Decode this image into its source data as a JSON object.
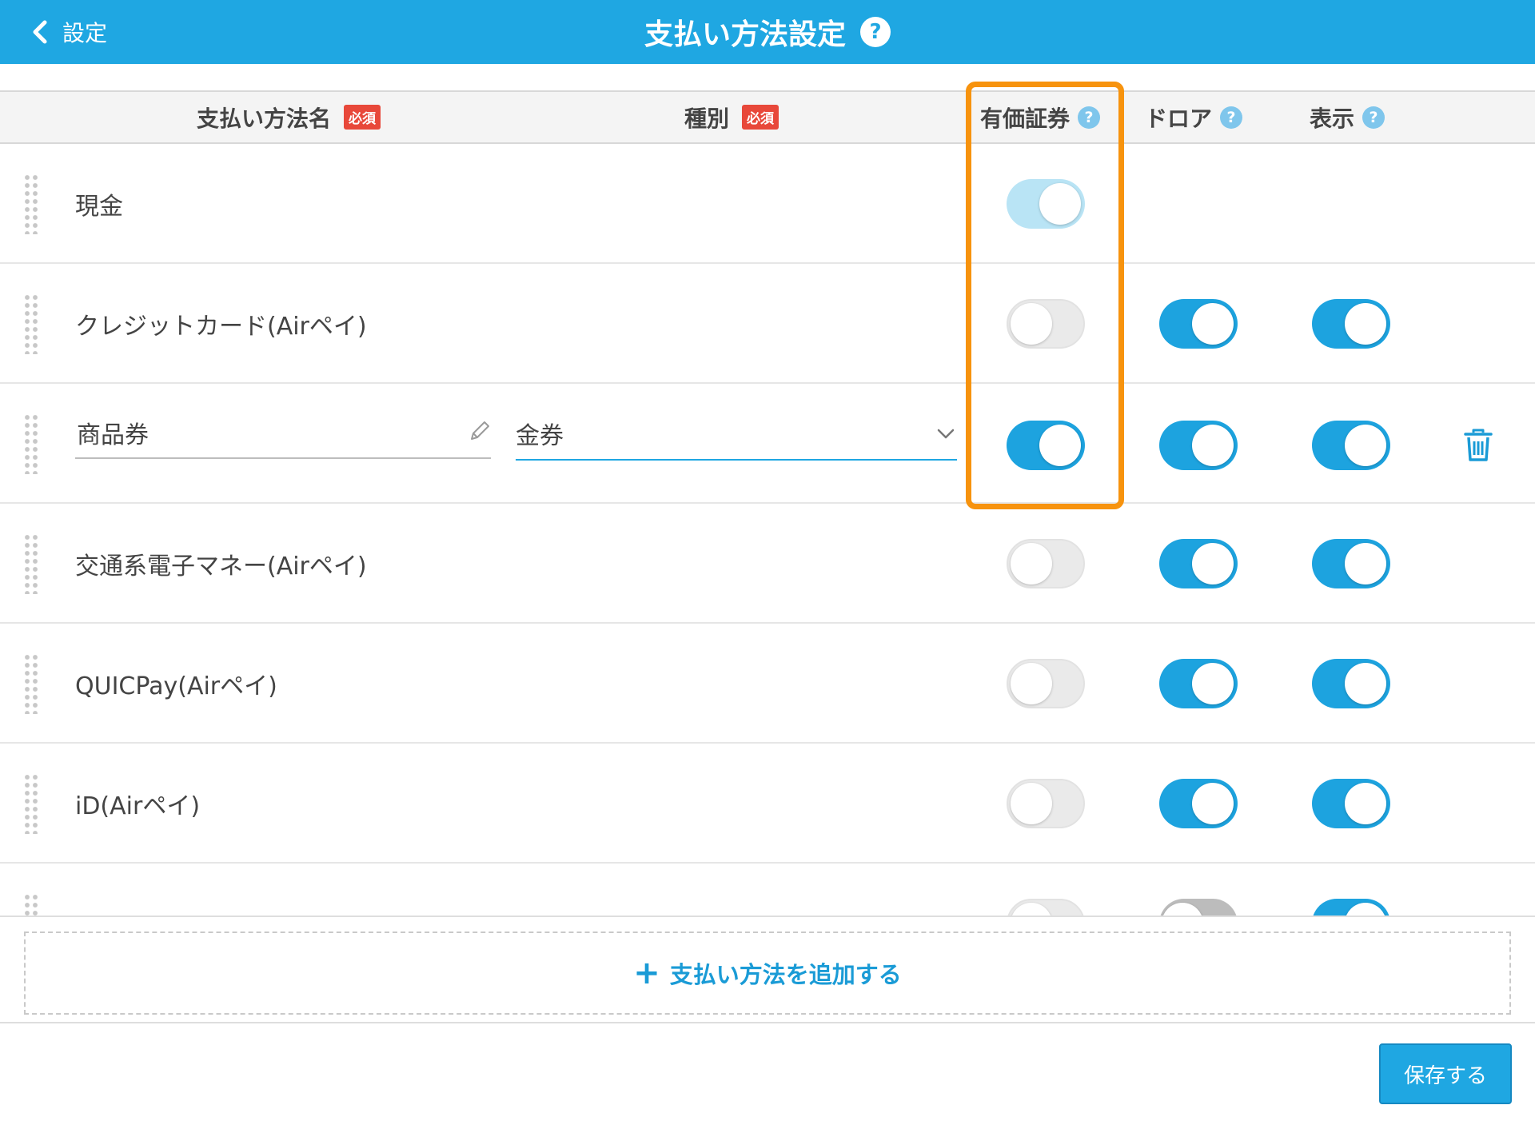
{
  "header": {
    "back_label": "設定",
    "title": "支払い方法設定",
    "help_symbol": "?"
  },
  "columns": {
    "name": "支払い方法名",
    "type": "種別",
    "required_badge": "必須",
    "securities": "有価証券",
    "drawer": "ドロア",
    "display": "表示",
    "help_symbol": "?"
  },
  "rows": [
    {
      "name": "現金",
      "securities": "on-disabled"
    },
    {
      "name": "クレジットカード(Airペイ)",
      "securities": "off",
      "drawer": "on",
      "display": "on"
    },
    {
      "name": "商品券",
      "type": "金券",
      "securities": "on",
      "drawer": "on",
      "display": "on",
      "editable": true
    },
    {
      "name": "交通系電子マネー(Airペイ)",
      "securities": "off",
      "drawer": "on",
      "display": "on"
    },
    {
      "name": "QUICPay(Airペイ)",
      "securities": "off",
      "drawer": "on",
      "display": "on"
    },
    {
      "name": "iD(Airペイ)",
      "securities": "off",
      "drawer": "on",
      "display": "on"
    }
  ],
  "actions": {
    "add_label": "支払い方法を追加する",
    "add_symbol": "+",
    "save_label": "保存する"
  },
  "colors": {
    "header": "#1fa7e2",
    "toggle_on": "#1da3df",
    "highlight": "#f7930e",
    "required": "#e8483a"
  }
}
